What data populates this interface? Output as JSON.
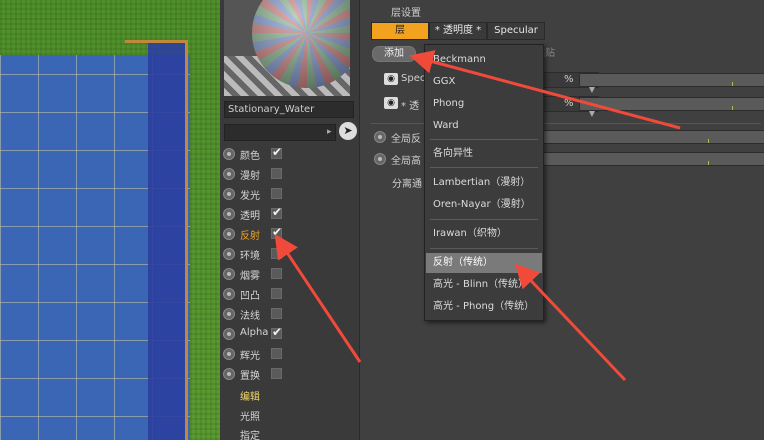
{
  "material": {
    "name": "Stationary_Water"
  },
  "channels": [
    {
      "label": "颜色",
      "checked": true,
      "active": false
    },
    {
      "label": "漫射",
      "checked": false,
      "active": false
    },
    {
      "label": "发光",
      "checked": false,
      "active": false
    },
    {
      "label": "透明",
      "checked": true,
      "active": false
    },
    {
      "label": "反射",
      "checked": true,
      "active": true
    },
    {
      "label": "环境",
      "checked": false,
      "active": false
    },
    {
      "label": "烟雾",
      "checked": false,
      "active": false
    },
    {
      "label": "凹凸",
      "checked": false,
      "active": false
    },
    {
      "label": "法线",
      "checked": false,
      "active": false
    },
    {
      "label": "Alpha",
      "checked": true,
      "active": false
    },
    {
      "label": "辉光",
      "checked": false,
      "active": false
    },
    {
      "label": "置换",
      "checked": false,
      "active": false
    }
  ],
  "sub_items": [
    "编辑",
    "光照",
    "指定"
  ],
  "right": {
    "title": "层设置",
    "tabs": [
      "层",
      "* 透明度 *",
      "Specular"
    ],
    "add_button": "添加",
    "paste_button": "粘贴",
    "layers": [
      {
        "name": "Specu",
        "pct_unit": "%"
      },
      {
        "name": "* 透",
        "pct_unit": "%"
      }
    ],
    "global": [
      {
        "name": "全局反"
      },
      {
        "name": "全局高"
      }
    ],
    "sep_label": "分离通"
  },
  "menu": {
    "items": [
      "Beckmann",
      "GGX",
      "Phong",
      "Ward",
      "各向异性",
      "Lambertian（漫射）",
      "Oren-Nayar（漫射）",
      "Irawan（织物）",
      "反射（传统）",
      "高光 - Blinn（传统）",
      "高光 - Phong（传统）"
    ],
    "highlighted": "反射（传统）"
  },
  "colors": {
    "accent": "#f2a21e",
    "arrow": "#f04a3a",
    "panel": "#404040"
  }
}
